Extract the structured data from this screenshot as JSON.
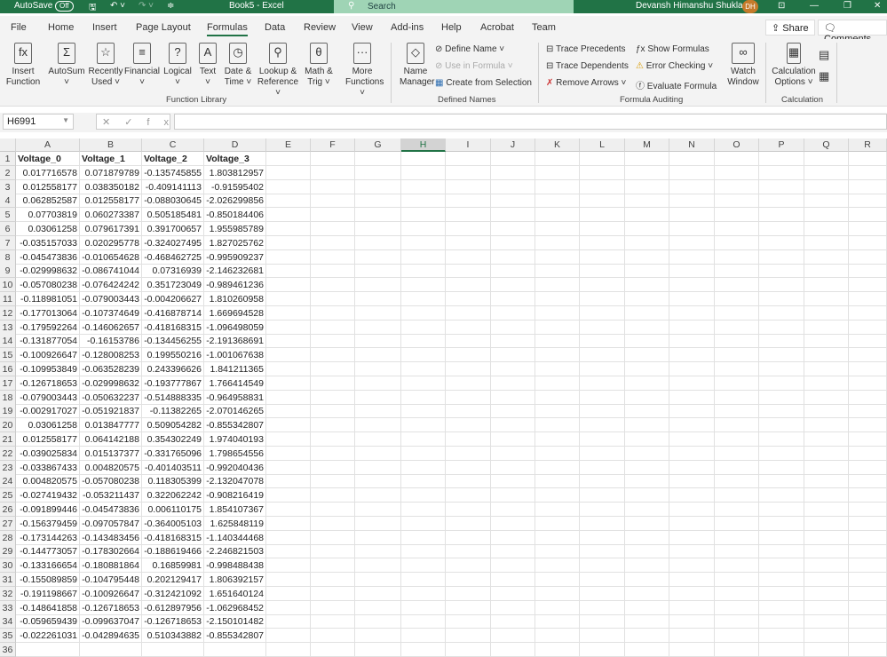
{
  "titlebar": {
    "autosave": "AutoSave",
    "toggle": "Off",
    "title": "Book5  -  Excel",
    "search": "Search",
    "user": "Devansh Himanshu Shukla",
    "initials": "DH"
  },
  "tabs": [
    "File",
    "Home",
    "Insert",
    "Page Layout",
    "Formulas",
    "Data",
    "Review",
    "View",
    "Add-ins",
    "Help",
    "Acrobat",
    "Team"
  ],
  "active_tab": "Formulas",
  "share": "Share",
  "comments": "Comments",
  "ribbon": {
    "function_library": {
      "label": "Function Library",
      "buttons": [
        {
          "l1": "Insert",
          "l2": "Function",
          "icon": "fx"
        },
        {
          "l1": "AutoSum",
          "l2": "˅",
          "icon": "Σ"
        },
        {
          "l1": "Recently",
          "l2": "Used ˅",
          "icon": "☆"
        },
        {
          "l1": "Financial",
          "l2": "˅",
          "icon": "≡"
        },
        {
          "l1": "Logical",
          "l2": "˅",
          "icon": "?"
        },
        {
          "l1": "Text",
          "l2": "˅",
          "icon": "A"
        },
        {
          "l1": "Date &",
          "l2": "Time ˅",
          "icon": "◷"
        },
        {
          "l1": "Lookup &",
          "l2": "Reference ˅",
          "icon": "⚲"
        },
        {
          "l1": "Math &",
          "l2": "Trig ˅",
          "icon": "θ"
        },
        {
          "l1": "More",
          "l2": "Functions ˅",
          "icon": "···"
        }
      ]
    },
    "defined_names": {
      "label": "Defined Names",
      "name_manager_1": "Name",
      "name_manager_2": "Manager",
      "define_name": "Define Name ˅",
      "use_in_formula": "Use in Formula ˅",
      "create_from_selection": "Create from Selection"
    },
    "formula_auditing": {
      "label": "Formula Auditing",
      "trace_precedents": "Trace Precedents",
      "trace_dependents": "Trace Dependents",
      "remove_arrows": "Remove Arrows ˅",
      "show_formulas": "Show Formulas",
      "error_checking": "Error Checking ˅",
      "evaluate_formula": "Evaluate Formula",
      "watch_1": "Watch",
      "watch_2": "Window"
    },
    "calculation": {
      "label": "Calculation",
      "options_1": "Calculation",
      "options_2": "Options ˅"
    }
  },
  "formula_bar": {
    "name_box": "H6991",
    "fx": "✕✓fx",
    "value": ""
  },
  "columns": [
    "A",
    "B",
    "C",
    "D",
    "E",
    "F",
    "G",
    "H",
    "I",
    "J",
    "K",
    "L",
    "M",
    "N",
    "O",
    "P",
    "Q",
    "R"
  ],
  "selected_column": "H",
  "headers": [
    "Voltage_0",
    "Voltage_1",
    "Voltage_2",
    "Voltage_3"
  ],
  "rows": [
    [
      "0.017716578",
      "0.071879789",
      "-0.135745855",
      "1.803812957"
    ],
    [
      "0.012558177",
      "0.038350182",
      "-0.409141113",
      "-0.91595402"
    ],
    [
      "0.062852587",
      "0.012558177",
      "-0.088030645",
      "-2.026299856"
    ],
    [
      "0.07703819",
      "0.060273387",
      "0.505185481",
      "-0.850184406"
    ],
    [
      "0.03061258",
      "0.079617391",
      "0.391700657",
      "1.955985789"
    ],
    [
      "-0.035157033",
      "0.020295778",
      "-0.324027495",
      "1.827025762"
    ],
    [
      "-0.045473836",
      "-0.010654628",
      "-0.468462725",
      "-0.995909237"
    ],
    [
      "-0.029998632",
      "-0.086741044",
      "0.07316939",
      "-2.146232681"
    ],
    [
      "-0.057080238",
      "-0.076424242",
      "0.351723049",
      "-0.989461236"
    ],
    [
      "-0.118981051",
      "-0.079003443",
      "-0.004206627",
      "1.810260958"
    ],
    [
      "-0.177013064",
      "-0.107374649",
      "-0.416878714",
      "1.669694528"
    ],
    [
      "-0.179592264",
      "-0.146062657",
      "-0.418168315",
      "-1.096498059"
    ],
    [
      "-0.131877054",
      "-0.16153786",
      "-0.134456255",
      "-2.191368691"
    ],
    [
      "-0.100926647",
      "-0.128008253",
      "0.199550216",
      "-1.001067638"
    ],
    [
      "-0.109953849",
      "-0.063528239",
      "0.243396626",
      "1.841211365"
    ],
    [
      "-0.126718653",
      "-0.029998632",
      "-0.193777867",
      "1.766414549"
    ],
    [
      "-0.079003443",
      "-0.050632237",
      "-0.514888335",
      "-0.964958831"
    ],
    [
      "-0.002917027",
      "-0.051921837",
      "-0.11382265",
      "-2.070146265"
    ],
    [
      "0.03061258",
      "0.013847777",
      "0.509054282",
      "-0.855342807"
    ],
    [
      "0.012558177",
      "0.064142188",
      "0.354302249",
      "1.974040193"
    ],
    [
      "-0.039025834",
      "0.015137377",
      "-0.331765096",
      "1.798654556"
    ],
    [
      "-0.033867433",
      "0.004820575",
      "-0.401403511",
      "-0.992040436"
    ],
    [
      "0.004820575",
      "-0.057080238",
      "0.118305399",
      "-2.132047078"
    ],
    [
      "-0.027419432",
      "-0.053211437",
      "0.322062242",
      "-0.908216419"
    ],
    [
      "-0.091899446",
      "-0.045473836",
      "0.006110175",
      "1.854107367"
    ],
    [
      "-0.156379459",
      "-0.097057847",
      "-0.364005103",
      "1.625848119"
    ],
    [
      "-0.173144263",
      "-0.143483456",
      "-0.418168315",
      "-1.140344468"
    ],
    [
      "-0.144773057",
      "-0.178302664",
      "-0.188619466",
      "-2.246821503"
    ],
    [
      "-0.133166654",
      "-0.180881864",
      "0.16859981",
      "-0.998488438"
    ],
    [
      "-0.155089859",
      "-0.104795448",
      "0.202129417",
      "1.806392157"
    ],
    [
      "-0.191198667",
      "-0.100926647",
      "-0.312421092",
      "1.651640124"
    ],
    [
      "-0.148641858",
      "-0.126718653",
      "-0.612897956",
      "-1.062968452"
    ],
    [
      "-0.059659439",
      "-0.099637047",
      "-0.126718653",
      "-2.150101482"
    ],
    [
      "-0.022261031",
      "-0.042894635",
      "0.510343882",
      "-0.855342807"
    ]
  ]
}
